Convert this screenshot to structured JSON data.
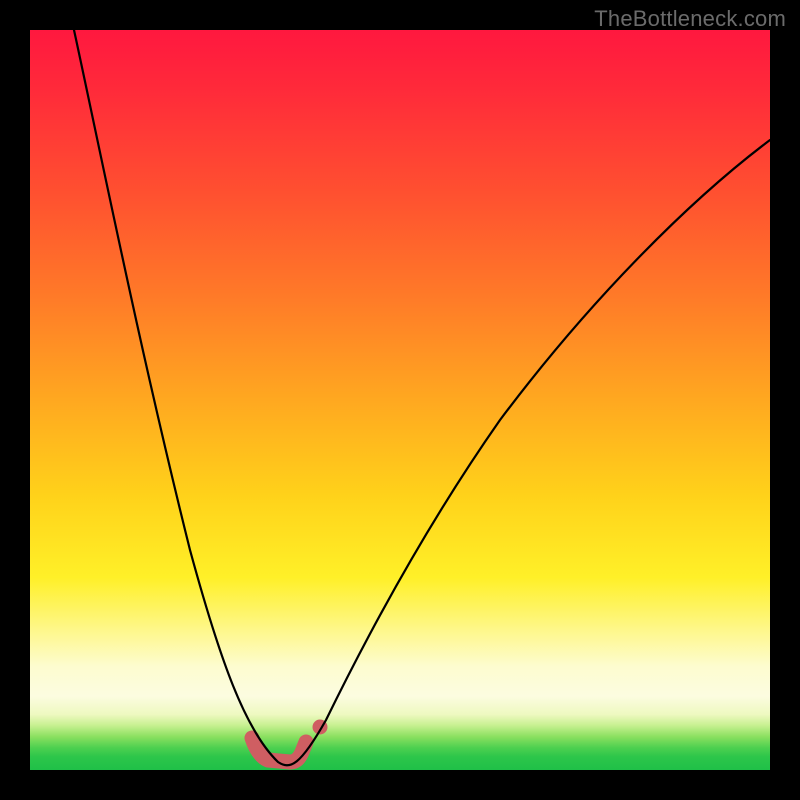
{
  "watermark": "TheBottleneck.com",
  "colors": {
    "background_frame": "#000000",
    "gradient_top": "#ff183f",
    "gradient_bottom": "#20c048",
    "curve": "#000000",
    "valley_marker": "#cf5e62"
  },
  "chart_data": {
    "type": "line",
    "title": "",
    "xlabel": "",
    "ylabel": "",
    "xlim": [
      0,
      100
    ],
    "ylim": [
      0,
      100
    ],
    "grid": false,
    "legend_position": "none",
    "annotations": [
      "TheBottleneck.com"
    ],
    "series": [
      {
        "name": "bottleneck-curve",
        "x": [
          6,
          10,
          14,
          18,
          22,
          26,
          28,
          30,
          32,
          33.5,
          35,
          37,
          40,
          45,
          52,
          60,
          70,
          80,
          90,
          100
        ],
        "y": [
          100,
          86,
          72,
          58,
          44,
          28,
          18,
          9,
          3,
          1,
          1,
          3,
          8,
          18,
          32,
          46,
          60,
          72,
          80,
          86
        ]
      }
    ],
    "valley_marker": {
      "x": [
        30,
        31,
        32,
        33,
        34,
        35,
        36,
        37
      ],
      "y": [
        4,
        2,
        1,
        1,
        1,
        1,
        2,
        4
      ],
      "extra_dot": {
        "x": 39,
        "y": 6
      }
    },
    "notes": "No axis ticks or numeric labels are rendered. y represents bottleneck magnitude where 0 is the ideal (green band) and 100 is worst (red). The curve dips to ~1 near x≈34 and rises on both sides."
  }
}
